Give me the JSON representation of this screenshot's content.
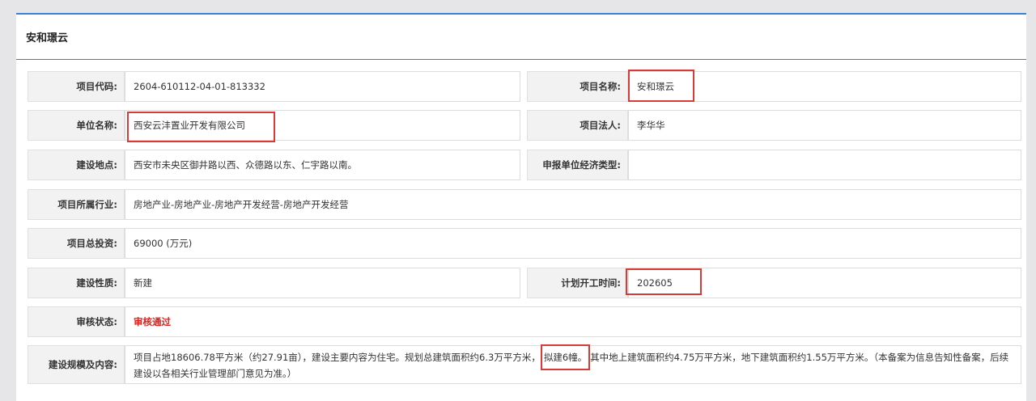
{
  "card": {
    "title": "安和璟云"
  },
  "fields": {
    "project_code": {
      "label": "项目代码:",
      "value": "2604-610112-04-01-813332"
    },
    "project_name": {
      "label": "项目名称:",
      "value": "安和璟云"
    },
    "unit_name": {
      "label": "单位名称:",
      "value": "西安云沣置业开发有限公司"
    },
    "legal_person": {
      "label": "项目法人:",
      "value": "李华华"
    },
    "location": {
      "label": "建设地点:",
      "value": "西安市未央区御井路以西、众德路以东、仁宇路以南。"
    },
    "economic_type": {
      "label": "申报单位经济类型:",
      "value": ""
    },
    "industry": {
      "label": "项目所属行业:",
      "value": "房地产业-房地产业-房地产开发经营-房地产开发经营"
    },
    "total_investment": {
      "label": "项目总投资:",
      "value": "69000 (万元)"
    },
    "nature": {
      "label": "建设性质:",
      "value": "新建"
    },
    "start_time": {
      "label": "计划开工时间:",
      "value": "202605"
    },
    "review_status": {
      "label": "审核状态:",
      "value": "审核通过"
    },
    "scale": {
      "label": "建设规模及内容:",
      "value_part1": "项目占地18606.78平方米（约27.91亩），建设主要内容为住宅。规划总建筑面积约6.3万平方米，",
      "value_highlight": "拟建6幢。",
      "value_part2": "其中地上建筑面积约4.75万平方米，地下建筑面积约1.55万平方米。（本备案为信息告知性备案，后续建设以各相关行业管理部门意见为准。）"
    }
  },
  "colors": {
    "accent": "#3b82d6",
    "highlight_box": "#d93a36",
    "status_text": "#d9201c"
  }
}
